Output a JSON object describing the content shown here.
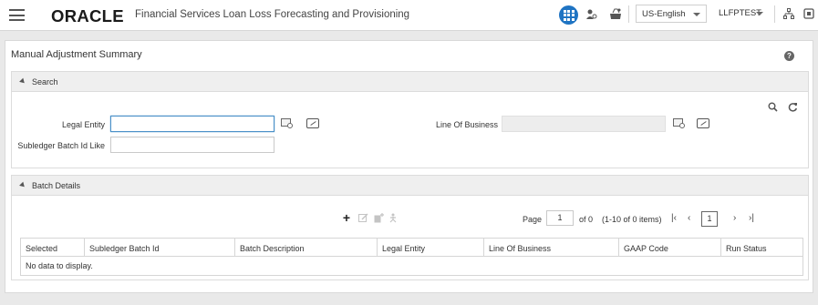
{
  "header": {
    "logo": "ORACLE",
    "app_title": "Financial Services Loan Loss Forecasting and Provisioning",
    "language": "US-English",
    "user": "LLFPTEST"
  },
  "page": {
    "title": "Manual Adjustment Summary",
    "help": "?"
  },
  "search": {
    "section_title": "Search",
    "legal_entity_label": "Legal Entity",
    "legal_entity_value": "",
    "line_of_business_label": "Line Of Business",
    "line_of_business_value": "",
    "subledger_batch_label": "Subledger Batch Id Like",
    "subledger_batch_value": ""
  },
  "batch": {
    "section_title": "Batch Details",
    "page_label": "Page",
    "page_value": "1",
    "of_label": "of 0",
    "items_label": "(1-10 of 0 items)",
    "current_page": "1",
    "columns": [
      "Selected",
      "Subledger Batch Id",
      "Batch Description",
      "Legal Entity",
      "Line Of Business",
      "GAAP Code",
      "Run Status"
    ],
    "empty_message": "No data to display."
  },
  "icons": {
    "add": "plus-icon",
    "edit": "edit-icon",
    "copy": "copy-icon",
    "run": "run-icon"
  }
}
